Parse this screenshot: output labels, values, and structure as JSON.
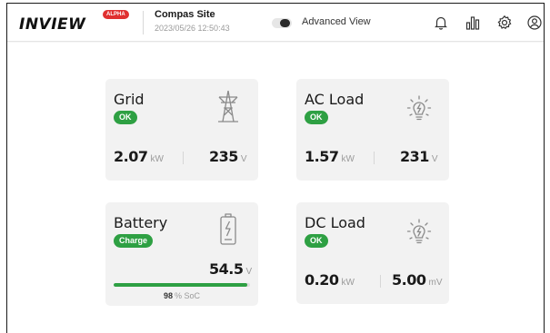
{
  "header": {
    "logo": "INVIEW",
    "logo_badge": "ALPHA",
    "site_name": "Compas Site",
    "timestamp": "2023/05/26 12:50:43",
    "advanced_view_label": "Advanced View",
    "advanced_view_on": false,
    "icons": [
      "bell-icon",
      "bar-chart-icon",
      "gear-icon",
      "user-icon"
    ]
  },
  "cards": {
    "grid": {
      "title": "Grid",
      "status": "OK",
      "power_value": "2.07",
      "power_unit": "kW",
      "voltage_value": "235",
      "voltage_unit": "V",
      "icon": "power-tower-icon"
    },
    "ac_load": {
      "title": "AC Load",
      "status": "OK",
      "power_value": "1.57",
      "power_unit": "kW",
      "voltage_value": "231",
      "voltage_unit": "V",
      "icon": "lightbulb-icon"
    },
    "battery": {
      "title": "Battery",
      "status": "Charge",
      "voltage_value": "54.5",
      "voltage_unit": "V",
      "soc_value": "98",
      "soc_label": "% SoC",
      "soc_fraction": 0.98,
      "icon": "battery-icon"
    },
    "dc_load": {
      "title": "DC Load",
      "status": "OK",
      "power_value": "0.20",
      "power_unit": "kW",
      "voltage_value": "5.00",
      "voltage_unit": "mV",
      "icon": "lightbulb-icon"
    }
  },
  "colors": {
    "status_green": "#2ea043",
    "card_bg": "#f2f2f2",
    "alpha_red": "#e03030"
  }
}
